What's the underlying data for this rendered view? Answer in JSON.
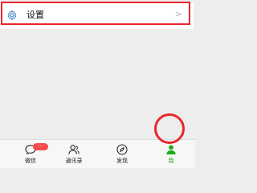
{
  "settings": {
    "label": "设置",
    "chevron": ">",
    "icon": "gear-icon"
  },
  "tabs": [
    {
      "label": "微信",
      "icon": "chat-icon",
      "badge": "···",
      "active": false
    },
    {
      "label": "通讯录",
      "icon": "contacts-icon",
      "active": false
    },
    {
      "label": "发现",
      "icon": "compass-icon",
      "active": false
    },
    {
      "label": "我",
      "icon": "person-icon",
      "active": true
    }
  ],
  "colors": {
    "accent": "#1aad19",
    "highlight": "#e8262b",
    "badge": "#f24a4a",
    "background": "#ededed"
  }
}
